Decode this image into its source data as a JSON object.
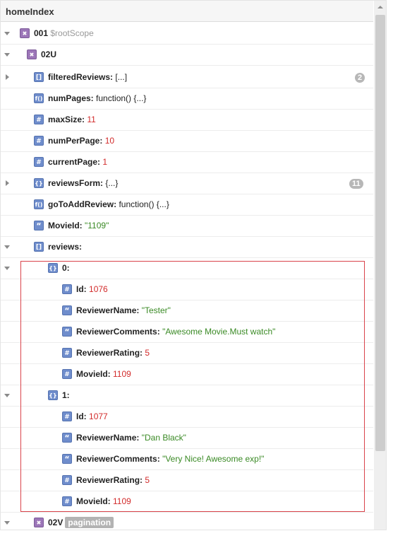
{
  "panel": {
    "title": "homeIndex"
  },
  "rows": {
    "r0": {
      "key": "001",
      "meta": "$rootScope"
    },
    "r1": {
      "key": "02U"
    },
    "r2": {
      "key": "filteredReviews:",
      "value": "[...]",
      "badge": "2"
    },
    "r3": {
      "key": "numPages:",
      "value": "function() {...}"
    },
    "r4": {
      "key": "maxSize:",
      "value": "11"
    },
    "r5": {
      "key": "numPerPage:",
      "value": "10"
    },
    "r6": {
      "key": "currentPage:",
      "value": "1"
    },
    "r7": {
      "key": "reviewsForm:",
      "value": "{...}",
      "badge": "11"
    },
    "r8": {
      "key": "goToAddReview:",
      "value": "function() {...}"
    },
    "r9": {
      "key": "MovieId:",
      "value": "\"1109\""
    },
    "r10": {
      "key": "reviews:"
    },
    "r11": {
      "key": "0:"
    },
    "r12": {
      "key": "Id:",
      "value": "1076"
    },
    "r13": {
      "key": "ReviewerName:",
      "value": "\"Tester\""
    },
    "r14": {
      "key": "ReviewerComments:",
      "value": "\"Awesome Movie.Must watch\""
    },
    "r15": {
      "key": "ReviewerRating:",
      "value": "5"
    },
    "r16": {
      "key": "MovieId:",
      "value": "1109"
    },
    "r17": {
      "key": "1:"
    },
    "r18": {
      "key": "Id:",
      "value": "1077"
    },
    "r19": {
      "key": "ReviewerName:",
      "value": "\"Dan Black\""
    },
    "r20": {
      "key": "ReviewerComments:",
      "value": "\"Very Nice! Awesome exp!\""
    },
    "r21": {
      "key": "ReviewerRating:",
      "value": "5"
    },
    "r22": {
      "key": "MovieId:",
      "value": "1109"
    },
    "r23": {
      "key": "02V",
      "tag": "pagination"
    }
  },
  "icons": {
    "scope": "scope-icon",
    "array": "[]",
    "function": "f()",
    "number": "#",
    "object": "{}",
    "string": "“"
  },
  "colors": {
    "number_value": "#d22b2b",
    "string_value": "#3a8a25",
    "highlight_border": "#d9434b",
    "scope_icon": "#9c76b8",
    "type_icon": "#6f8dcc"
  }
}
